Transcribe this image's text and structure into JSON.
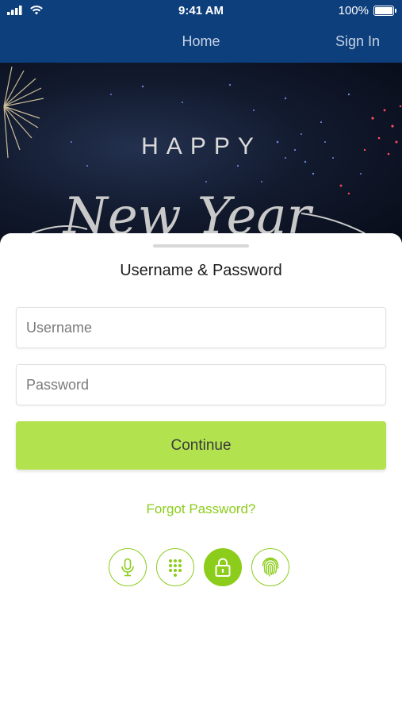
{
  "status_bar": {
    "time": "9:41 AM",
    "battery": "100%",
    "icons": [
      "signal-icon",
      "wifi-icon",
      "battery-icon"
    ]
  },
  "nav": {
    "home_label": "Home",
    "sign_in_label": "Sign In"
  },
  "banner": {
    "line1": "HAPPY",
    "line2": "New Year"
  },
  "login": {
    "title": "Username & Password",
    "username_placeholder": "Username",
    "password_placeholder": "Password",
    "continue_label": "Continue",
    "forgot_label": "Forgot Password?",
    "methods": [
      {
        "icon": "microphone-icon",
        "active": false
      },
      {
        "icon": "keypad-icon",
        "active": false
      },
      {
        "icon": "lock-icon",
        "active": true
      },
      {
        "icon": "fingerprint-icon",
        "active": false
      }
    ]
  },
  "colors": {
    "nav_blue": "#0d3f7d",
    "accent_green": "#8ccd1b",
    "button_green": "#b3e24f"
  }
}
